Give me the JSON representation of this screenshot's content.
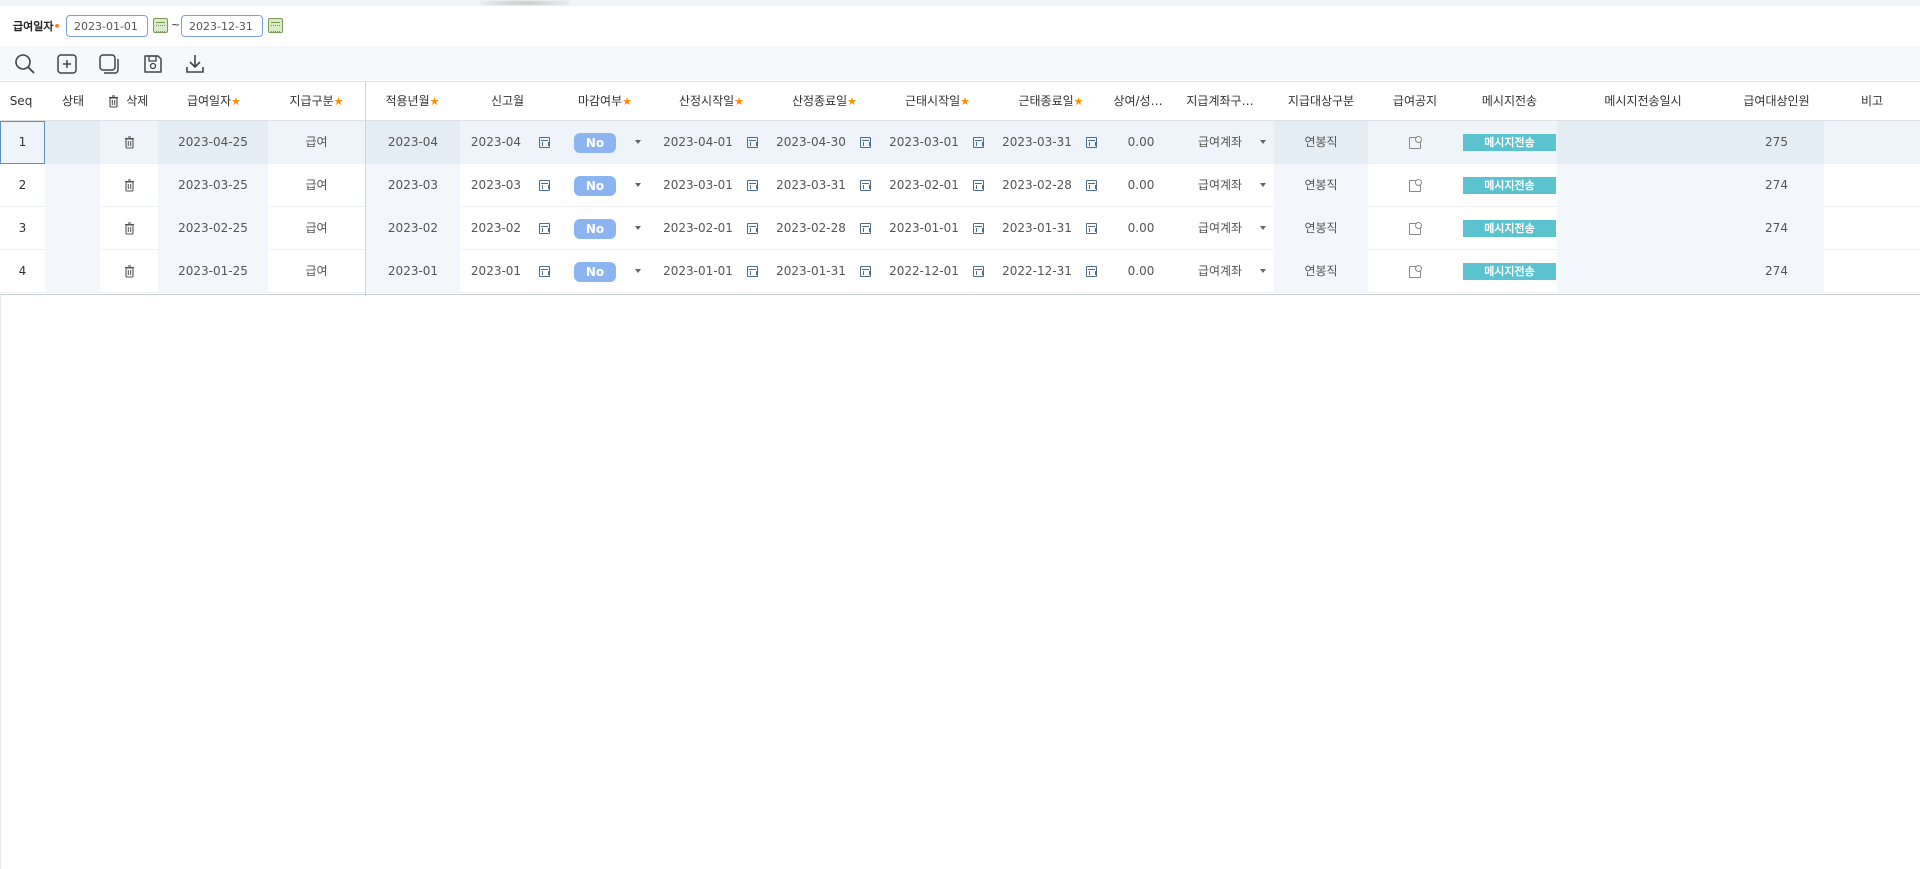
{
  "filter": {
    "label": "급여일자",
    "required_mark": "•",
    "start_date": "2023-01-01",
    "tilde": "~",
    "end_date": "2023-12-31"
  },
  "toolbar": {
    "buttons": [
      "search-icon",
      "add-icon",
      "copy-icon",
      "save-icon",
      "download-icon"
    ]
  },
  "grid": {
    "columns": {
      "seq": "Seq",
      "status": "상태",
      "delete": "삭제",
      "pay_date": "급여일자",
      "pay_type": "지급구분",
      "apply_month": "적용년월",
      "report_month": "신고월",
      "closed": "마감여부",
      "calc_start": "산정시작일",
      "calc_end": "산정종료일",
      "work_start": "근태시작일",
      "work_end": "근태종료일",
      "bonus": "상여/성…",
      "account": "지급계좌구…",
      "target": "지급대상구분",
      "notice": "급여공지",
      "msg": "메시지전송",
      "msg_time": "메시지전송일시",
      "headcount": "급여대상인원",
      "note": "비고"
    },
    "required_star": "★",
    "rows": [
      {
        "seq": "1",
        "pay_date": "2023-04-25",
        "pay_type": "급여",
        "apply_month": "2023-04",
        "report_month": "2023-04",
        "closed": "No",
        "calc_start": "2023-04-01",
        "calc_end": "2023-04-30",
        "work_start": "2023-03-01",
        "work_end": "2023-03-31",
        "bonus": "0.00",
        "account": "급여계좌",
        "target": "연봉직",
        "msg": "메시지전송",
        "headcount": "275"
      },
      {
        "seq": "2",
        "pay_date": "2023-03-25",
        "pay_type": "급여",
        "apply_month": "2023-03",
        "report_month": "2023-03",
        "closed": "No",
        "calc_start": "2023-03-01",
        "calc_end": "2023-03-31",
        "work_start": "2023-02-01",
        "work_end": "2023-02-28",
        "bonus": "0.00",
        "account": "급여계좌",
        "target": "연봉직",
        "msg": "메시지전송",
        "headcount": "274"
      },
      {
        "seq": "3",
        "pay_date": "2023-02-25",
        "pay_type": "급여",
        "apply_month": "2023-02",
        "report_month": "2023-02",
        "closed": "No",
        "calc_start": "2023-02-01",
        "calc_end": "2023-02-28",
        "work_start": "2023-01-01",
        "work_end": "2023-01-31",
        "bonus": "0.00",
        "account": "급여계좌",
        "target": "연봉직",
        "msg": "메시지전송",
        "headcount": "274"
      },
      {
        "seq": "4",
        "pay_date": "2023-01-25",
        "pay_type": "급여",
        "apply_month": "2023-01",
        "report_month": "2023-01",
        "closed": "No",
        "calc_start": "2023-01-01",
        "calc_end": "2023-01-31",
        "work_start": "2022-12-01",
        "work_end": "2022-12-31",
        "bonus": "0.00",
        "account": "급여계좌",
        "target": "연봉직",
        "msg": "메시지전송",
        "headcount": "274"
      }
    ]
  },
  "colors": {
    "accent_blue": "#5d8fc2",
    "pill_blue": "#8cb4f0",
    "msg_teal": "#5bc2cf",
    "required_orange": "#ff8a00"
  }
}
